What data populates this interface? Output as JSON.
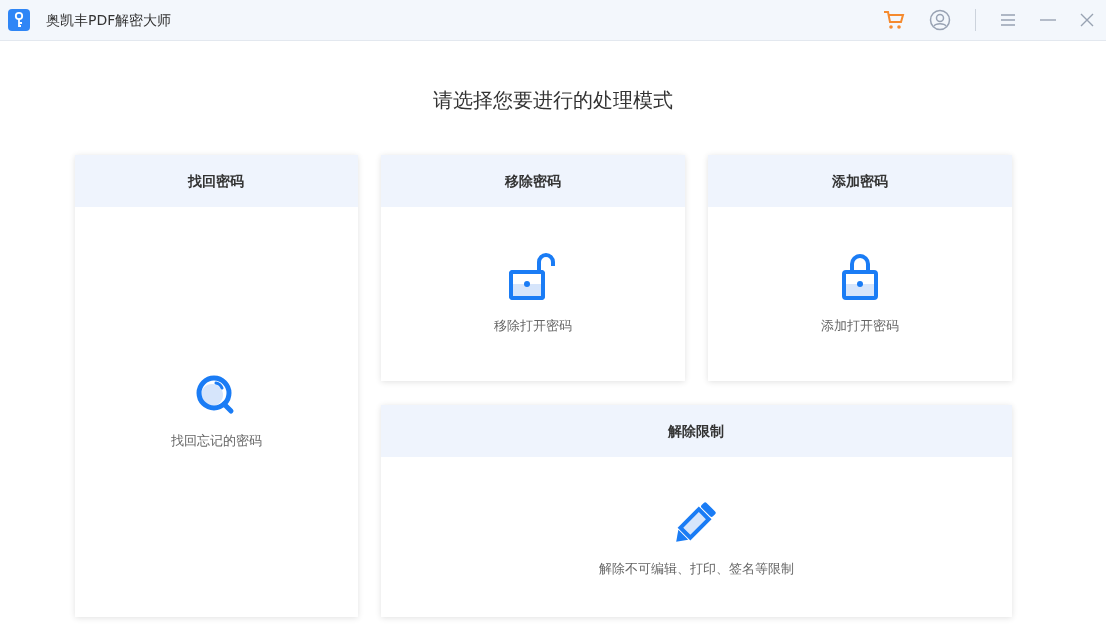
{
  "window": {
    "title": "奥凯丰PDF解密大师"
  },
  "heading": "请选择您要进行的处理模式",
  "modes": [
    {
      "title": "找回密码",
      "caption": "找回忘记的密码"
    },
    {
      "title": "移除密码",
      "caption": "移除打开密码"
    },
    {
      "title": "添加密码",
      "caption": "添加打开密码"
    },
    {
      "title": "解除限制",
      "caption": "解除不可编辑、打印、签名等限制"
    }
  ]
}
